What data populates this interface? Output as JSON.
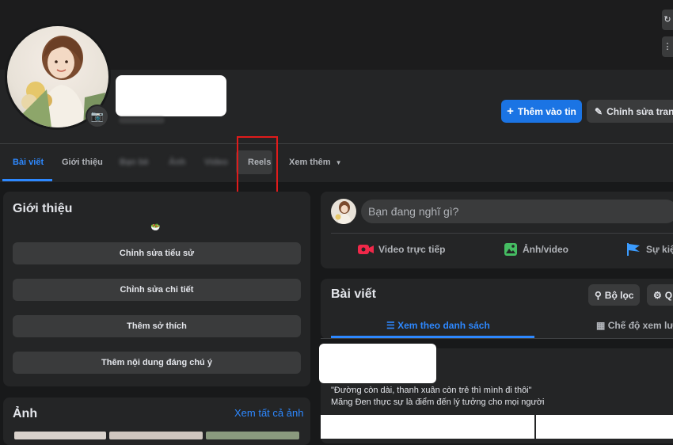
{
  "profile": {
    "add_story_label": "Thêm vào tin",
    "edit_profile_label": "Chỉnh sửa trang"
  },
  "tabs": [
    {
      "label": "Bài viết",
      "active": true
    },
    {
      "label": "Giới thiệu"
    },
    {
      "label": "Bạn bè"
    },
    {
      "label": "Ảnh"
    },
    {
      "label": "Video"
    },
    {
      "label": "Reels"
    },
    {
      "label": "Xem thêm"
    }
  ],
  "intro": {
    "title": "Giới thiệu",
    "buttons": [
      "Chỉnh sửa tiểu sử",
      "Chỉnh sửa chi tiết",
      "Thêm sở thích",
      "Thêm nội dung đáng chú ý"
    ]
  },
  "photos": {
    "title": "Ảnh",
    "see_all": "Xem tất cả ảnh"
  },
  "composer": {
    "placeholder": "Bạn đang nghĩ gì?",
    "actions": [
      "Video trực tiếp",
      "Ảnh/video",
      "Sự kiện"
    ]
  },
  "posts": {
    "title": "Bài viết",
    "filter_label": "Bộ lọc",
    "manage_label": "Q",
    "list_view_label": "Xem theo danh sách",
    "grid_view_label": "Chế độ xem lưới"
  },
  "feed_post": {
    "line1": "\"Đường còn dài, thanh xuân còn trẻ thì mình đi thôi\"",
    "line2": "Măng Đen thực sự là điểm đến lý tưởng cho mọi người"
  },
  "colors": {
    "accent": "#2d88ff",
    "primary_button": "#1b74e4",
    "highlight_box": "#e01b1b"
  }
}
